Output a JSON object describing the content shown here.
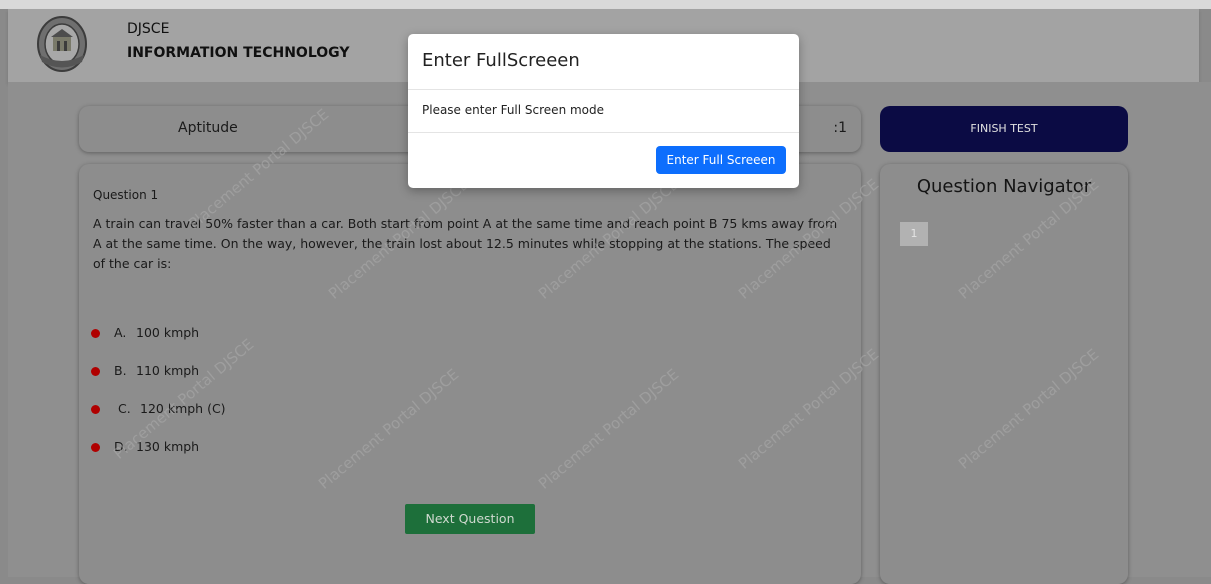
{
  "header": {
    "college": "DJSCE",
    "department": "INFORMATION TECHNOLOGY",
    "logo_icon": "college-crest-logo"
  },
  "section_tab": {
    "label": "Aptitude",
    "timer_suffix": ":1"
  },
  "finish_button": {
    "label": "FINISH TEST"
  },
  "question": {
    "number_label": "Question 1",
    "text": "A train can travel 50% faster than a car. Both start from point A at the same time and reach point B 75 kms away from A at the same time. On the way, however, the train lost about 12.5 minutes while stopping at the stations. The speed of the car is:",
    "options": [
      {
        "letter": "A.",
        "text": "100 kmph"
      },
      {
        "letter": "B.",
        "text": "110 kmph"
      },
      {
        "letter": "C.",
        "text": "120 kmph (C)"
      },
      {
        "letter": "D.",
        "text": "130 kmph"
      }
    ]
  },
  "next_button": {
    "label": "Next Question"
  },
  "navigator": {
    "title": "Question Navigator",
    "items": [
      {
        "label": "1"
      }
    ]
  },
  "watermark": {
    "text": "Placement Portal DJSCE"
  },
  "modal": {
    "title": "Enter FullScreeen",
    "body": "Please enter Full Screen mode",
    "button": "Enter Full Screeen"
  },
  "colors": {
    "finish_button_bg": "#0b0b44",
    "next_button_bg": "#1d6f3a",
    "modal_button_bg": "#0d6efd",
    "option_dot": "#b00000"
  }
}
